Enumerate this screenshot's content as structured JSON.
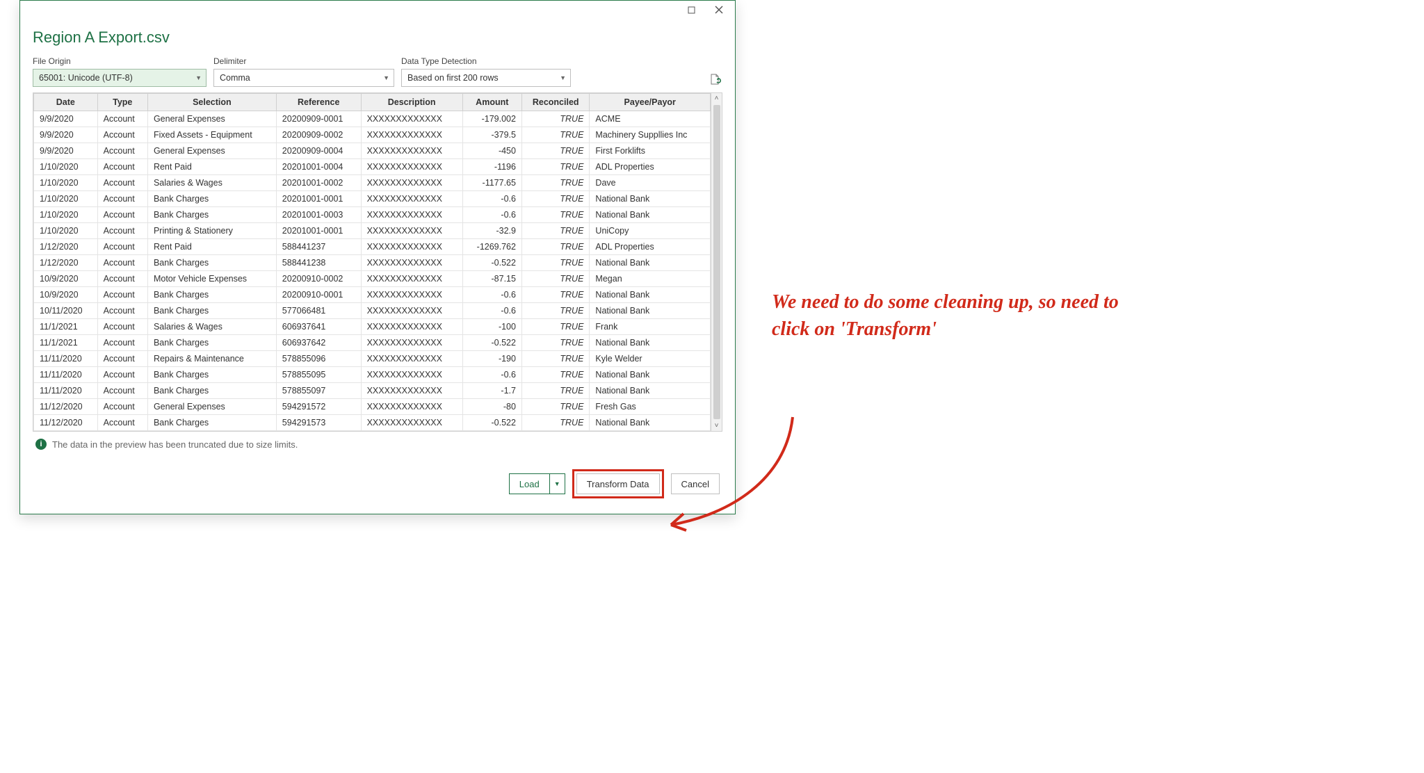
{
  "window": {
    "title": "Region A Export.csv"
  },
  "controls": {
    "file_origin": {
      "label": "File Origin",
      "value": "65001: Unicode (UTF-8)"
    },
    "delimiter": {
      "label": "Delimiter",
      "value": "Comma"
    },
    "detection": {
      "label": "Data Type Detection",
      "value": "Based on first 200 rows"
    }
  },
  "table": {
    "headers": [
      "Date",
      "Type",
      "Selection",
      "Reference",
      "Description",
      "Amount",
      "Reconciled",
      "Payee/Payor"
    ],
    "rows": [
      [
        "9/9/2020",
        "Account",
        "General Expenses",
        "20200909-0001",
        "XXXXXXXXXXXXX",
        "-179.002",
        "TRUE",
        "ACME"
      ],
      [
        "9/9/2020",
        "Account",
        "Fixed Assets - Equipment",
        "20200909-0002",
        "XXXXXXXXXXXXX",
        "-379.5",
        "TRUE",
        "Machinery Suppllies Inc"
      ],
      [
        "9/9/2020",
        "Account",
        "General Expenses",
        "20200909-0004",
        "XXXXXXXXXXXXX",
        "-450",
        "TRUE",
        "First Forklifts"
      ],
      [
        "1/10/2020",
        "Account",
        "Rent Paid",
        "20201001-0004",
        "XXXXXXXXXXXXX",
        "-1196",
        "TRUE",
        "ADL Properties"
      ],
      [
        "1/10/2020",
        "Account",
        "Salaries & Wages",
        "20201001-0002",
        "XXXXXXXXXXXXX",
        "-1177.65",
        "TRUE",
        "Dave"
      ],
      [
        "1/10/2020",
        "Account",
        "Bank Charges",
        "20201001-0001",
        "XXXXXXXXXXXXX",
        "-0.6",
        "TRUE",
        "National Bank"
      ],
      [
        "1/10/2020",
        "Account",
        "Bank Charges",
        "20201001-0003",
        "XXXXXXXXXXXXX",
        "-0.6",
        "TRUE",
        "National Bank"
      ],
      [
        "1/10/2020",
        "Account",
        "Printing & Stationery",
        "20201001-0001",
        "XXXXXXXXXXXXX",
        "-32.9",
        "TRUE",
        "UniCopy"
      ],
      [
        "1/12/2020",
        "Account",
        "Rent Paid",
        "588441237",
        "XXXXXXXXXXXXX",
        "-1269.762",
        "TRUE",
        "ADL Properties"
      ],
      [
        "1/12/2020",
        "Account",
        "Bank Charges",
        "588441238",
        "XXXXXXXXXXXXX",
        "-0.522",
        "TRUE",
        "National Bank"
      ],
      [
        "10/9/2020",
        "Account",
        "Motor Vehicle Expenses",
        "20200910-0002",
        "XXXXXXXXXXXXX",
        "-87.15",
        "TRUE",
        "Megan"
      ],
      [
        "10/9/2020",
        "Account",
        "Bank Charges",
        "20200910-0001",
        "XXXXXXXXXXXXX",
        "-0.6",
        "TRUE",
        "National Bank"
      ],
      [
        "10/11/2020",
        "Account",
        "Bank Charges",
        "577066481",
        "XXXXXXXXXXXXX",
        "-0.6",
        "TRUE",
        "National Bank"
      ],
      [
        "11/1/2021",
        "Account",
        "Salaries & Wages",
        "606937641",
        "XXXXXXXXXXXXX",
        "-100",
        "TRUE",
        "Frank"
      ],
      [
        "11/1/2021",
        "Account",
        "Bank Charges",
        "606937642",
        "XXXXXXXXXXXXX",
        "-0.522",
        "TRUE",
        "National Bank"
      ],
      [
        "11/11/2020",
        "Account",
        "Repairs & Maintenance",
        "578855096",
        "XXXXXXXXXXXXX",
        "-190",
        "TRUE",
        "Kyle Welder"
      ],
      [
        "11/11/2020",
        "Account",
        "Bank Charges",
        "578855095",
        "XXXXXXXXXXXXX",
        "-0.6",
        "TRUE",
        "National Bank"
      ],
      [
        "11/11/2020",
        "Account",
        "Bank Charges",
        "578855097",
        "XXXXXXXXXXXXX",
        "-1.7",
        "TRUE",
        "National Bank"
      ],
      [
        "11/12/2020",
        "Account",
        "General Expenses",
        "594291572",
        "XXXXXXXXXXXXX",
        "-80",
        "TRUE",
        "Fresh Gas"
      ],
      [
        "11/12/2020",
        "Account",
        "Bank Charges",
        "594291573",
        "XXXXXXXXXXXXX",
        "-0.522",
        "TRUE",
        "National Bank"
      ]
    ]
  },
  "info_message": "The data in the preview has been truncated due to size limits.",
  "buttons": {
    "load": "Load",
    "transform": "Transform Data",
    "cancel": "Cancel"
  },
  "annotation": "We need to do some cleaning up, so need to click on 'Transform'"
}
